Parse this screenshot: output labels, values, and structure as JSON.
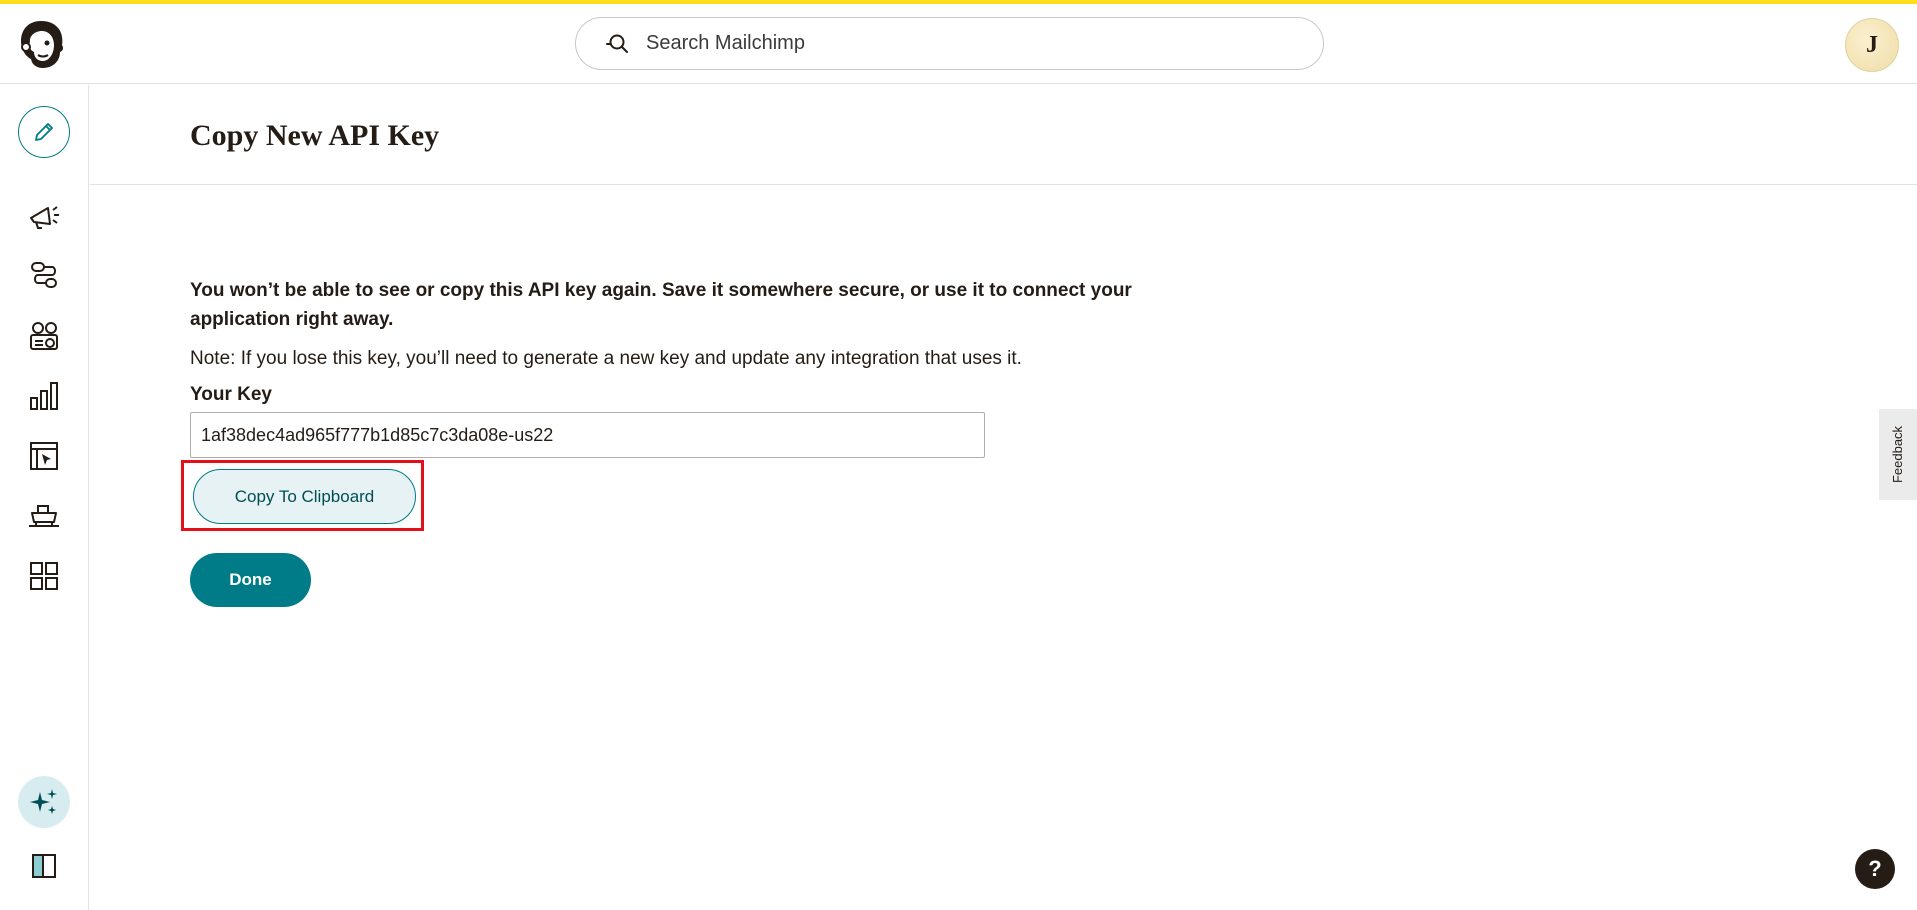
{
  "search": {
    "placeholder": "Search Mailchimp"
  },
  "user": {
    "avatar_letter": "J"
  },
  "page": {
    "title": "Copy New API Key"
  },
  "content": {
    "message": "You won’t be able to see or copy this API key again. Save it somewhere secure, or use it to connect your application right away.",
    "note": "Note: If you lose this key, you’ll need to generate a new key and update any integration that uses it.",
    "key_label": "Your Key",
    "key_value": "1af38dec4ad965f777b1d85c7c3da08e-us22",
    "copy_label": "Copy To Clipboard",
    "done_label": "Done"
  },
  "feedback": {
    "label": "Feedback"
  },
  "help": {
    "label": "?"
  },
  "colors": {
    "accent": "#007c89",
    "brand_yellow": "#ffe01b",
    "highlight": "#e3101b"
  },
  "sidebar": {
    "icons": [
      "pencil-icon",
      "megaphone-icon",
      "automation-icon",
      "audience-icon",
      "analytics-icon",
      "website-icon",
      "content-icon",
      "integrations-icon",
      "sparkle-icon",
      "collapse-icon"
    ]
  }
}
